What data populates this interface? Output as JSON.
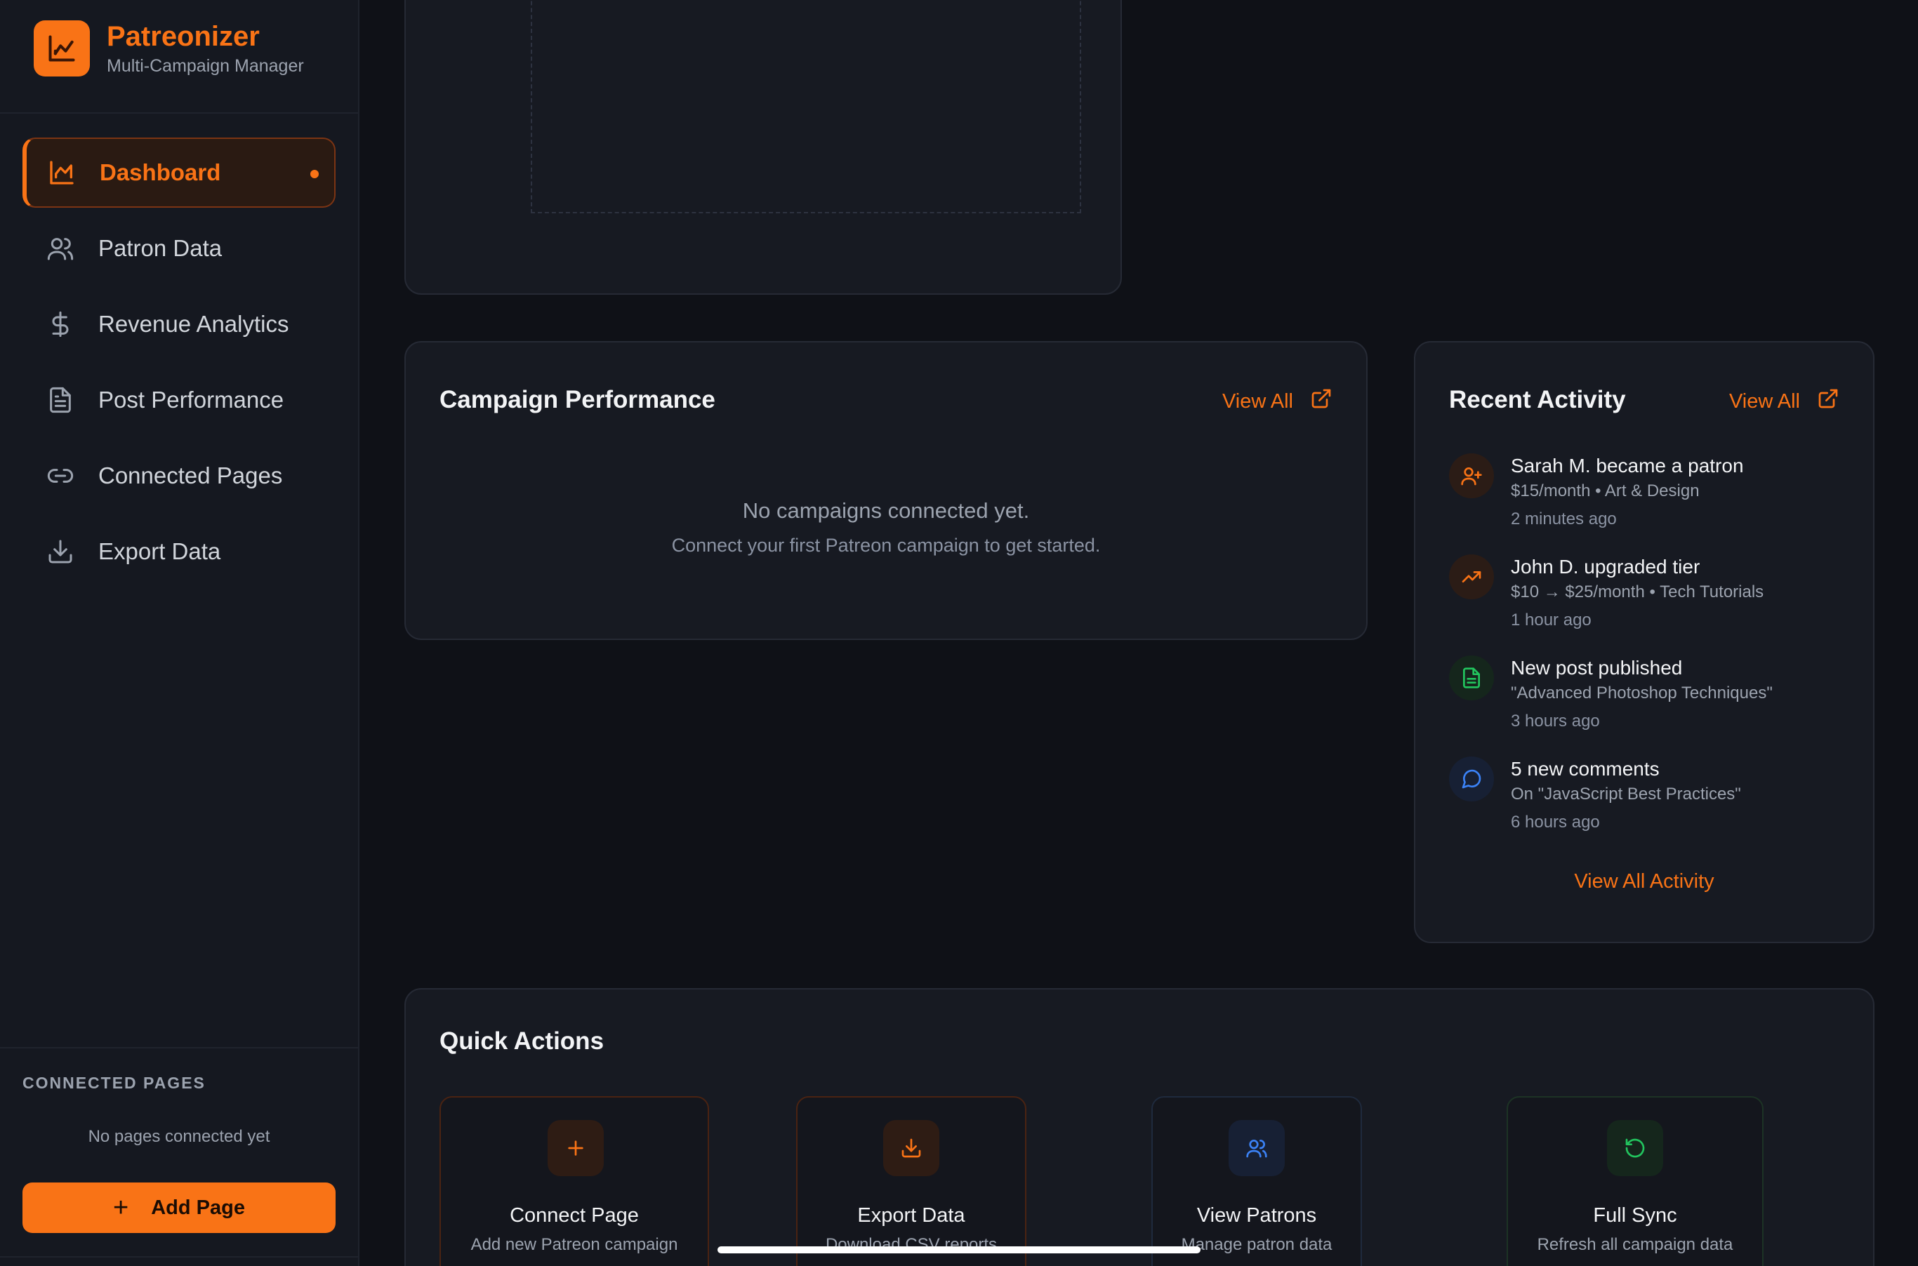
{
  "app": {
    "name": "Patreonizer",
    "subtitle": "Multi-Campaign Manager"
  },
  "sidebar": {
    "items": [
      {
        "label": "Dashboard",
        "icon": "chart-icon",
        "active": true
      },
      {
        "label": "Patron Data",
        "icon": "users-icon"
      },
      {
        "label": "Revenue Analytics",
        "icon": "dollar-icon"
      },
      {
        "label": "Post Performance",
        "icon": "document-icon"
      },
      {
        "label": "Connected Pages",
        "icon": "link-icon"
      },
      {
        "label": "Export Data",
        "icon": "download-icon"
      }
    ],
    "connected_pages_title": "CONNECTED PAGES",
    "connected_pages_empty": "No pages connected yet",
    "add_page_label": "Add Page"
  },
  "campaign_performance": {
    "title": "Campaign Performance",
    "view_all": "View All",
    "empty_title": "No campaigns connected yet.",
    "empty_subtitle": "Connect your first Patreon campaign to get started."
  },
  "recent_activity": {
    "title": "Recent Activity",
    "view_all": "View All",
    "items": [
      {
        "title": "Sarah M. became a patron",
        "subtitle": "$15/month • Art & Design",
        "time": "2 minutes ago",
        "icon": "user-plus-icon",
        "color": "#f97316"
      },
      {
        "title": "John D. upgraded tier",
        "subtitle": "$10 → $25/month • Tech Tutorials",
        "time": "1 hour ago",
        "icon": "trending-up-icon",
        "color": "#f97316"
      },
      {
        "title": "New post published",
        "subtitle": "\"Advanced Photoshop Techniques\"",
        "time": "3 hours ago",
        "icon": "document-icon",
        "color": "#22c55e"
      },
      {
        "title": "5 new comments",
        "subtitle": "On \"JavaScript Best Practices\"",
        "time": "6 hours ago",
        "icon": "comment-icon",
        "color": "#3b82f6"
      }
    ],
    "view_all_activity": "View All Activity"
  },
  "quick_actions": {
    "title": "Quick Actions",
    "items": [
      {
        "title": "Connect Page",
        "subtitle": "Add new Patreon campaign",
        "icon": "plus-icon",
        "color": "#f97316"
      },
      {
        "title": "Export Data",
        "subtitle": "Download CSV reports",
        "icon": "download-icon",
        "color": "#f97316"
      },
      {
        "title": "View Patrons",
        "subtitle": "Manage patron data",
        "icon": "users-icon",
        "color": "#3b82f6"
      },
      {
        "title": "Full Sync",
        "subtitle": "Refresh all campaign data",
        "icon": "refresh-icon",
        "color": "#22c55e"
      }
    ]
  },
  "colors": {
    "accent": "#f97316",
    "background": "#0f1117",
    "card": "#171a22",
    "green": "#22c55e",
    "blue": "#3b82f6"
  }
}
